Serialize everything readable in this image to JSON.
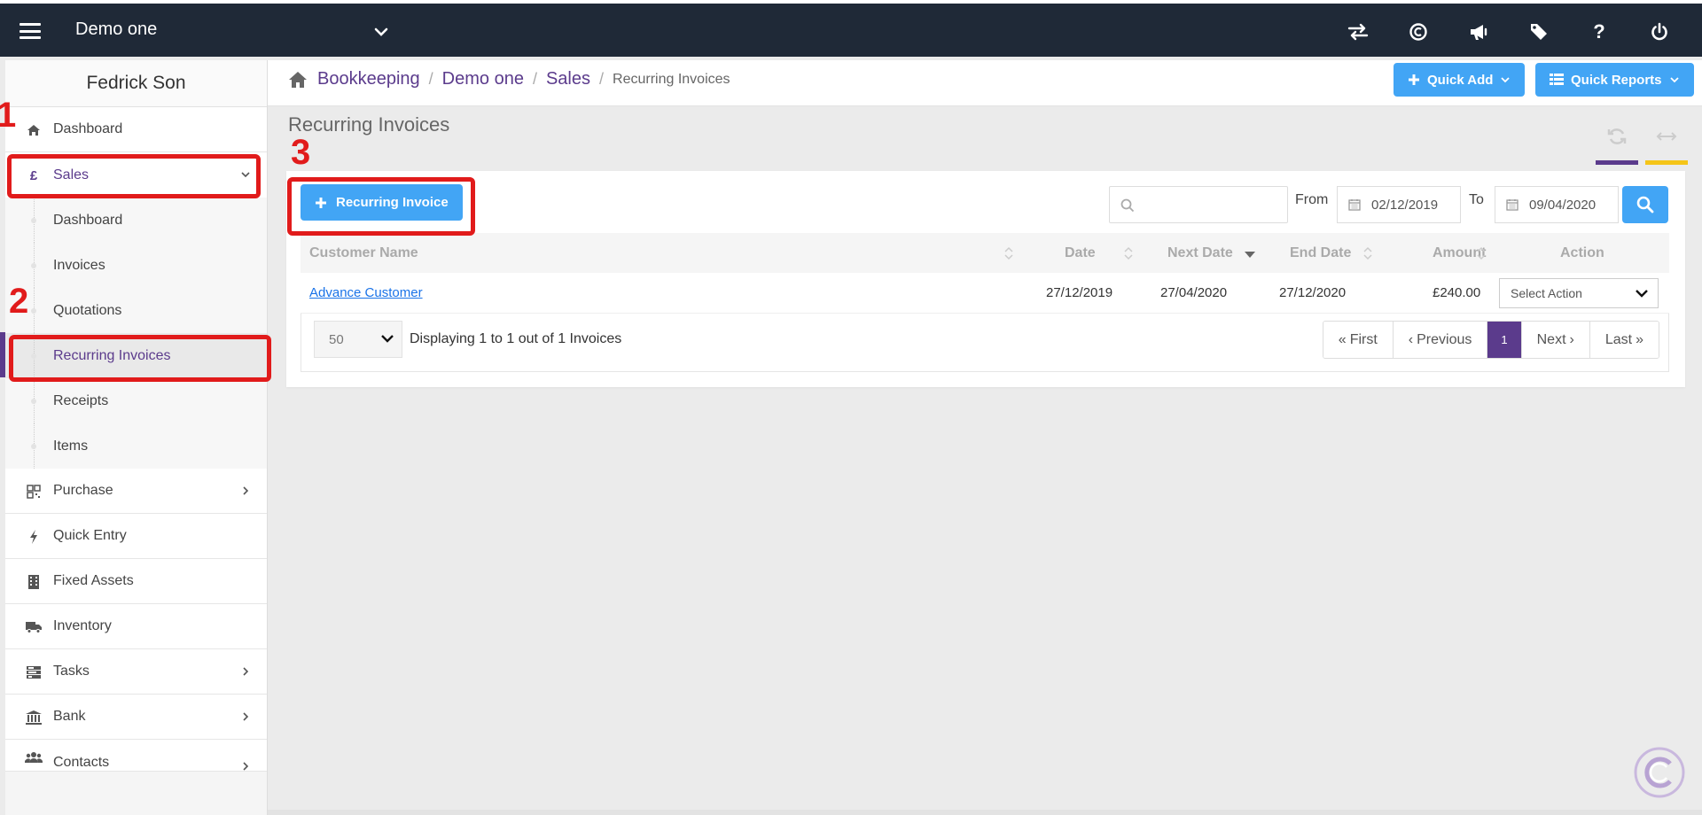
{
  "topbar": {
    "company": "Demo one",
    "icons": [
      "transfer-icon",
      "currency-c-icon",
      "megaphone-icon",
      "ticket-icon",
      "help-icon",
      "power-icon"
    ],
    "help_glyph": "?"
  },
  "sidebar": {
    "user_name": "Fedrick Son",
    "items": {
      "dashboard": "Dashboard",
      "sales": "Sales",
      "sales_symbol": "£",
      "purchase": "Purchase",
      "quick_entry": "Quick Entry",
      "fixed_assets": "Fixed Assets",
      "inventory": "Inventory",
      "tasks": "Tasks",
      "bank": "Bank",
      "contacts": "Contacts"
    },
    "sales_sub": [
      "Dashboard",
      "Invoices",
      "Quotations",
      "Recurring Invoices",
      "Receipts",
      "Items"
    ],
    "active_sub": "Recurring Invoices"
  },
  "breadcrumb": {
    "items": [
      "Bookkeeping",
      "Demo one",
      "Sales"
    ],
    "current": "Recurring Invoices",
    "separator": "/"
  },
  "header_buttons": {
    "quick_add": "Quick Add",
    "quick_reports": "Quick Reports"
  },
  "page": {
    "title": "Recurring Invoices",
    "add_button": "Recurring Invoice"
  },
  "filters": {
    "search_value": "",
    "from_label": "From",
    "from_date": "02/12/2019",
    "to_label": "To",
    "to_date": "09/04/2020"
  },
  "table": {
    "columns": [
      "Customer Name",
      "Date",
      "Next Date",
      "End Date",
      "Amount",
      "Action"
    ],
    "rows": [
      {
        "customer": "Advance Customer",
        "date": "27/12/2019",
        "next_date": "27/04/2020",
        "end_date": "27/12/2020",
        "amount": "£240.00",
        "action": "Select Action"
      }
    ]
  },
  "pagination": {
    "page_size": "50",
    "display_text": "Displaying 1 to 1 out of 1 Invoices",
    "first": "First",
    "previous": "Previous",
    "current": "1",
    "next": "Next",
    "last": "Last"
  },
  "annotations": [
    "1",
    "2",
    "3"
  ],
  "colors": {
    "topbar": "#1f2937",
    "accent_purple": "#5b3b8c",
    "button_blue": "#42a5f5",
    "annotation_red": "#e11b1b",
    "tool_yellow": "#f5c518"
  }
}
